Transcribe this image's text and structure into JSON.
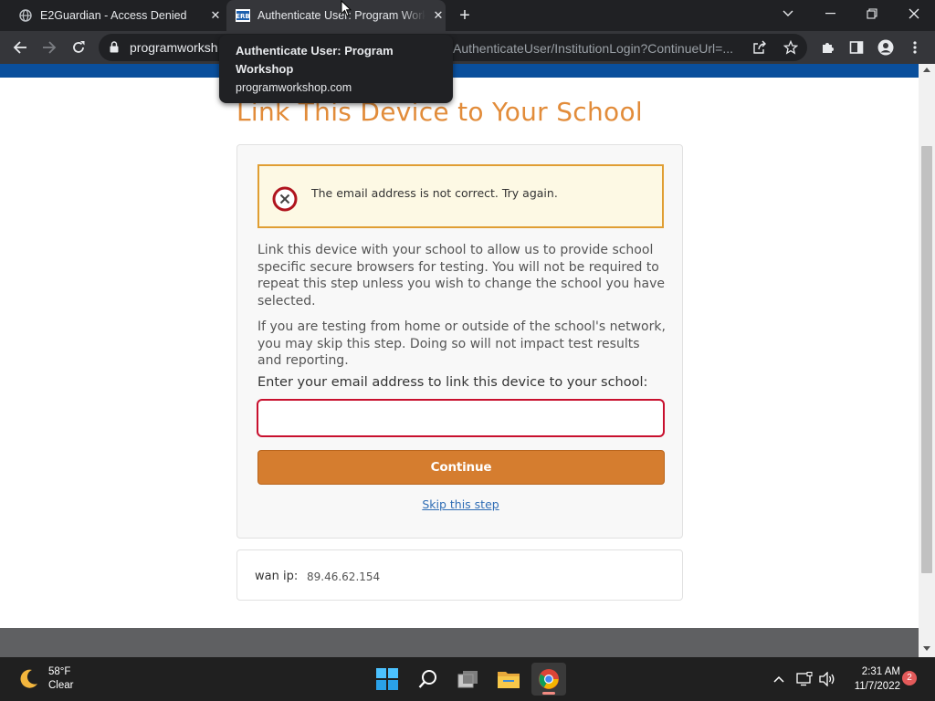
{
  "browser": {
    "tabs": [
      {
        "title": "E2Guardian - Access Denied",
        "favicon": "globe-icon",
        "active": false
      },
      {
        "title": "Authenticate User: Program Workshop",
        "favicon": "erb-favicon",
        "favicon_text": "ERB",
        "active": true
      }
    ],
    "address": {
      "host": "programworksh",
      "path": "AuthenticateUser/InstitutionLogin?ContinueUrl=..."
    },
    "hover_card": {
      "title": "Authenticate User: Program Workshop",
      "domain": "programworkshop.com"
    }
  },
  "page": {
    "title": "Link This Device to Your School",
    "alert": {
      "icon": "error-circle-icon",
      "message": "The email address is not correct. Try again."
    },
    "paragraphs": [
      "Link this device with your school to allow us to provide school specific secure browsers for testing. You will not be required to repeat this step unless you wish to change the school you have selected.",
      "If you are testing from home or outside of the school's network, you may skip this step. Doing so will not impact test results and reporting."
    ],
    "email_label": "Enter your email address to link this device to your school:",
    "email_value": "",
    "continue_label": "Continue",
    "skip_label": "Skip this step",
    "wan_ip_label": "wan ip:",
    "wan_ip_value": "89.46.62.154"
  },
  "colors": {
    "title_orange": "#e28c3a",
    "button_orange": "#d57d2f",
    "alert_border": "#e09e33",
    "error_red": "#c8102e",
    "top_bar_blue": "#0a4f9c"
  },
  "taskbar": {
    "weather": {
      "temp": "58°F",
      "condition": "Clear",
      "icon": "moon-icon"
    },
    "apps": [
      "windows-start-icon",
      "search-icon",
      "task-view-icon",
      "file-explorer-icon",
      "chrome-icon"
    ],
    "clock": {
      "time": "2:31 AM",
      "date": "11/7/2022"
    },
    "notifications": "2"
  }
}
